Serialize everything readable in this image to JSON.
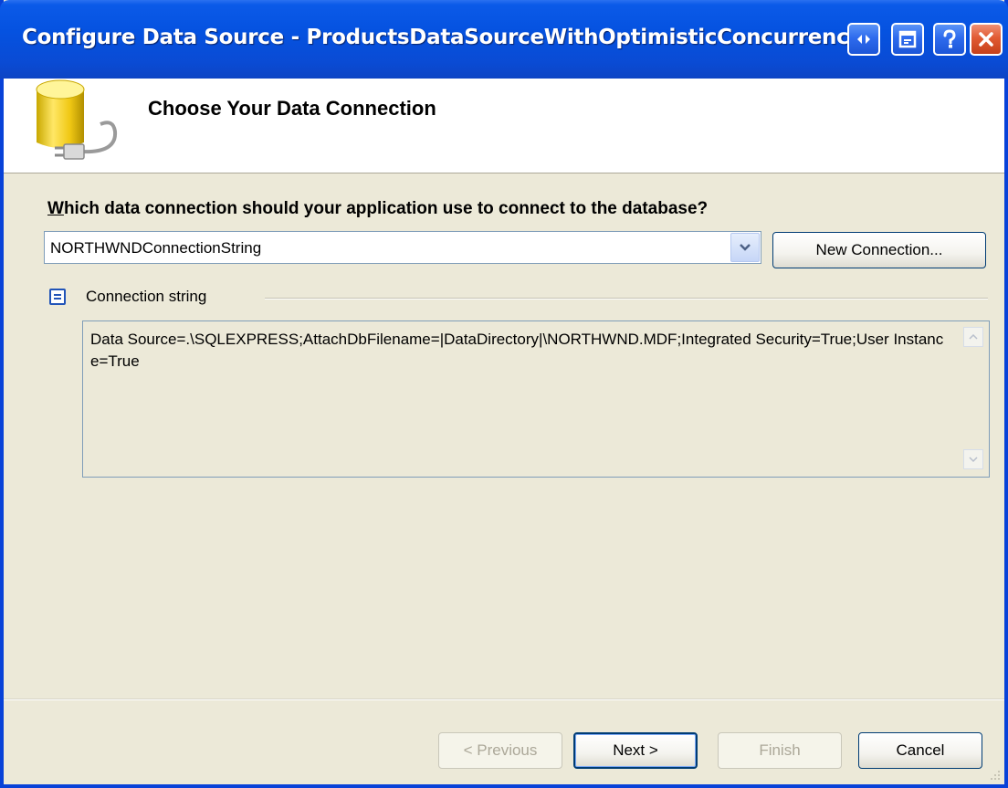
{
  "window": {
    "title": "Configure Data Source - ProductsDataSourceWithOptimisticConcurrency",
    "colors": {
      "titlebar": "#0552e0",
      "close": "#e15b33",
      "dialog_bg": "#ece9d8"
    }
  },
  "header": {
    "title": "Choose Your Data Connection",
    "icon": "database-plug-icon"
  },
  "connection": {
    "question_prefix": "W",
    "question_rest": "hich data connection should your application use to connect to the database?",
    "selected": "NORTHWNDConnectionString",
    "new_connection_label": "New Connection..."
  },
  "connection_string": {
    "label": "Connection string",
    "value": "Data Source=.\\SQLEXPRESS;AttachDbFilename=|DataDirectory|\\NORTHWND.MDF;Integrated Security=True;User Instance=True"
  },
  "footer": {
    "previous_label": "< Previous",
    "next_label": "Next >",
    "finish_label": "Finish",
    "cancel_label": "Cancel"
  }
}
